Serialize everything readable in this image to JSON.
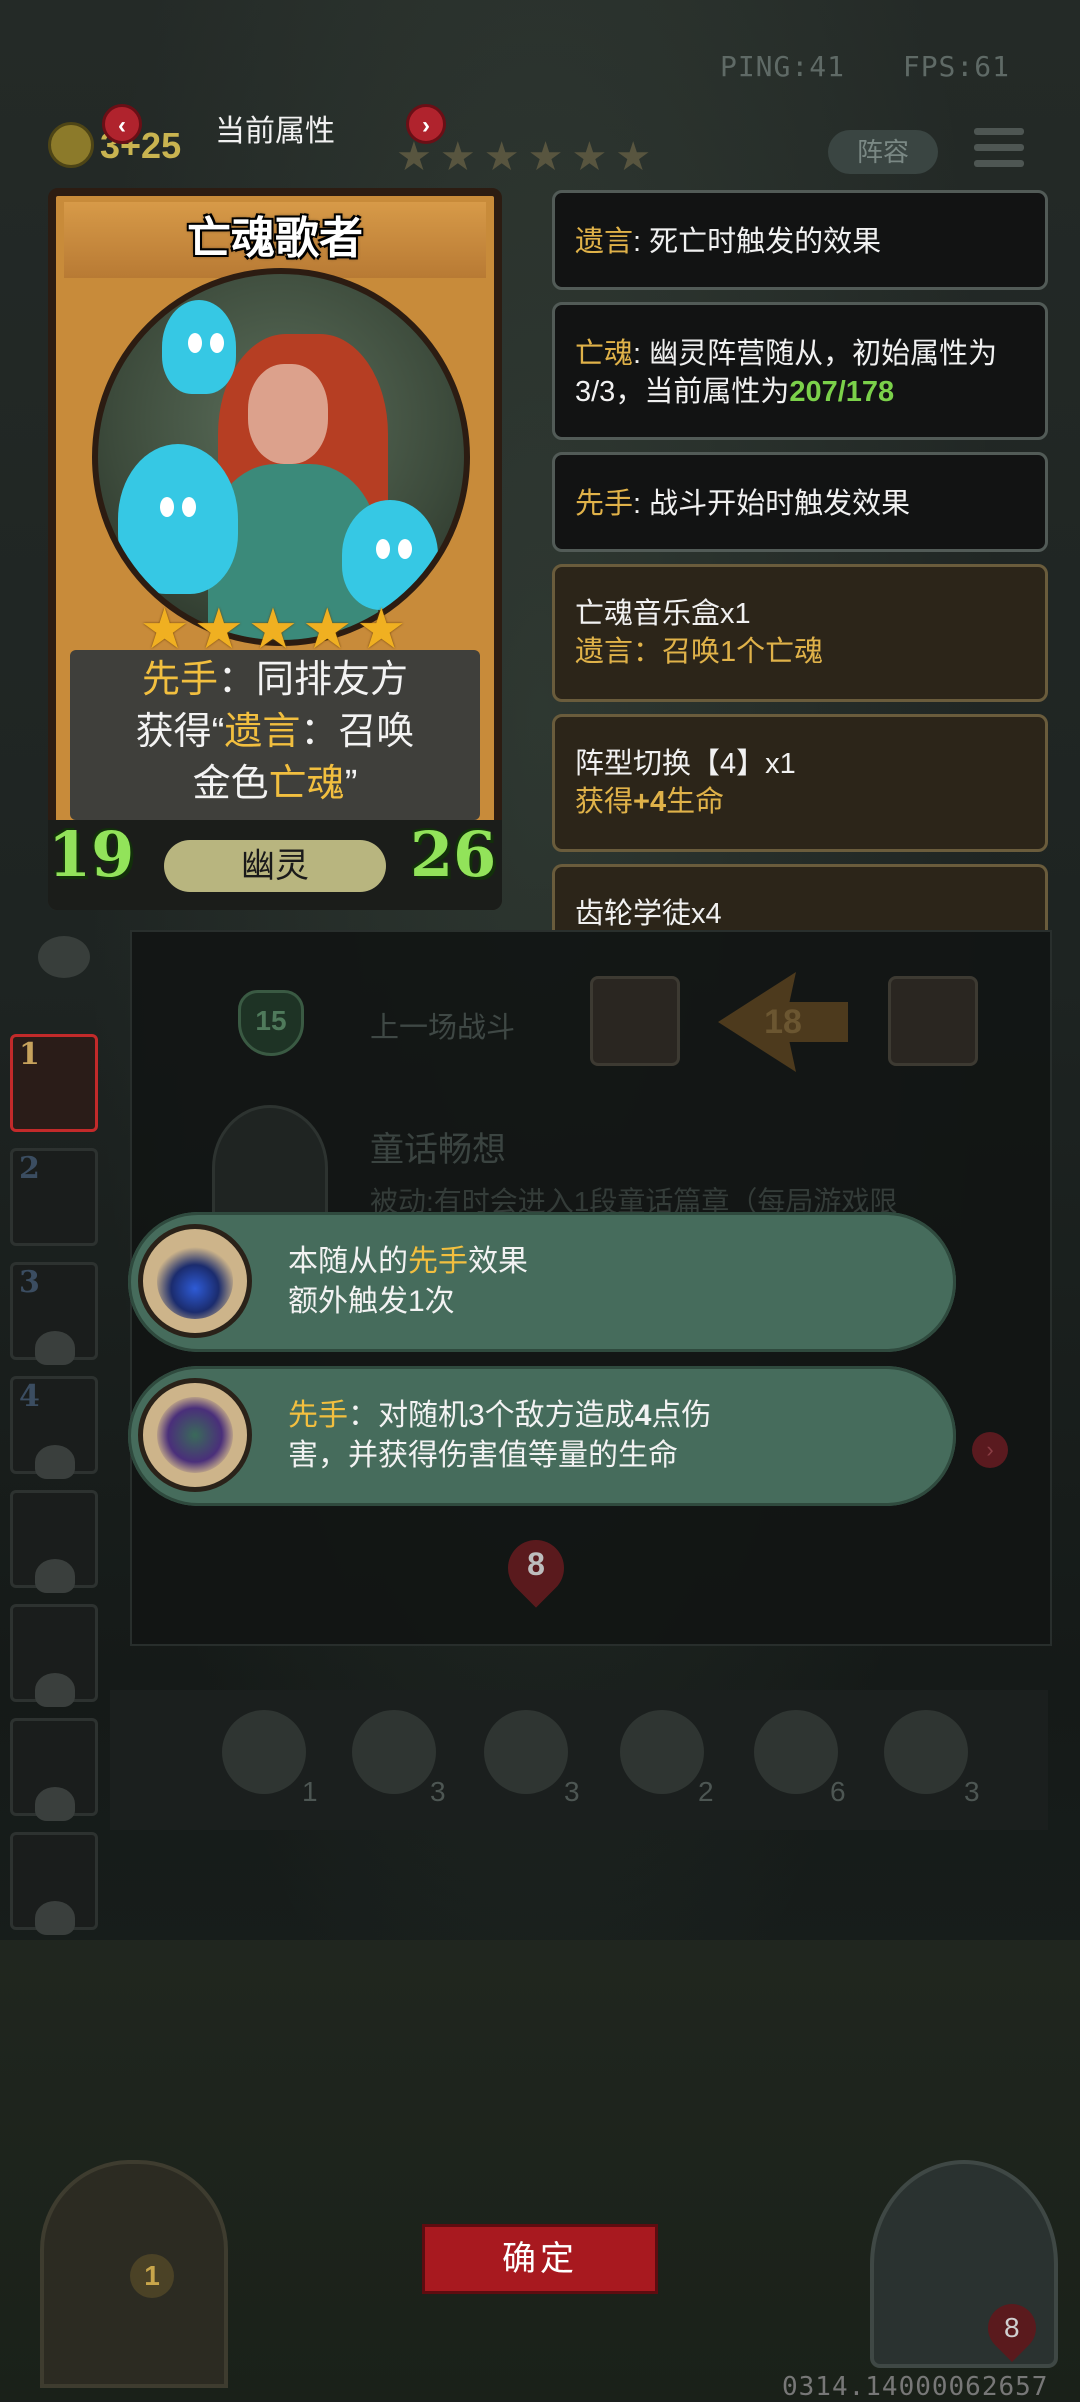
{
  "hud": {
    "ping": "PING:41",
    "fps": "FPS:61",
    "gold": "3+25",
    "top_stars": "★★★★★★",
    "lineup_label": "阵容"
  },
  "header": {
    "title": "当前属性",
    "prev": "‹",
    "next": "›"
  },
  "card": {
    "name": "亡魂歌者",
    "stars": "★★★★★",
    "desc": {
      "l1a": "先手",
      "l1b": "：同排友方",
      "l2a": "获得“",
      "l2b": "遗言",
      "l2c": "：召唤",
      "l3a": "金色",
      "l3b": "亡魂",
      "l3c": "”"
    },
    "tribe": "幽灵",
    "attack": "19",
    "health": "26"
  },
  "keywords": [
    {
      "k": "遗言",
      "text": ": 死亡时触发的效果"
    },
    {
      "k": "亡魂",
      "text": ": 幽灵阵营随从，初始属性为",
      "line2": "3/3，当前属性为",
      "stat": "207/178"
    },
    {
      "k": "先手",
      "text": ": 战斗开始时触发效果"
    }
  ],
  "equips": [
    {
      "name": "亡魂音乐盒x1",
      "effect": "遗言：召唤1个亡魂"
    },
    {
      "name": "阵型切换【4】x1",
      "effect_pre": "获得",
      "effect_bold": "+4",
      "effect_post": "生命"
    },
    {
      "name": "齿轮学徒x4"
    }
  ],
  "panel": {
    "shield_value": "15",
    "last_battle": "上一场战斗",
    "damage": "18",
    "skill_title": "童话畅想",
    "skill_line": "被动:有时会进入1段童话篇章（每局游戏限",
    "badge_value": "8"
  },
  "bubbles": [
    {
      "l1a": "本随从的",
      "l1b": "先手",
      "l1c": "效果",
      "l2": "额外触发1次"
    },
    {
      "l1a": "先手",
      "l1b": "：对随机3个敌方造成",
      "l1c": "4",
      "l1d": "点伤",
      "l2": "害，并获得伤害值等量的生命"
    }
  ],
  "slots": [
    "1",
    "2",
    "3",
    "4",
    "",
    "",
    "",
    ""
  ],
  "items": [
    {
      "name": "mirror-shield-icon",
      "count": "1"
    },
    {
      "name": "alarm-clock-icon",
      "count": "3"
    },
    {
      "name": "teacup-icon",
      "count": "3"
    },
    {
      "name": "cupcake-icon",
      "count": "2"
    },
    {
      "name": "bird-toy-icon",
      "count": "6"
    },
    {
      "name": "clown-icon",
      "count": "3"
    }
  ],
  "door_count": "1",
  "hero_hp": "8",
  "confirm": "确定",
  "build_id": "0314.14000062657",
  "colors": {
    "accent_gold": "#f2bf3f",
    "stat_green": "#7bd14a",
    "confirm_red": "#a8191f",
    "bubble_green": "#466c5c"
  }
}
